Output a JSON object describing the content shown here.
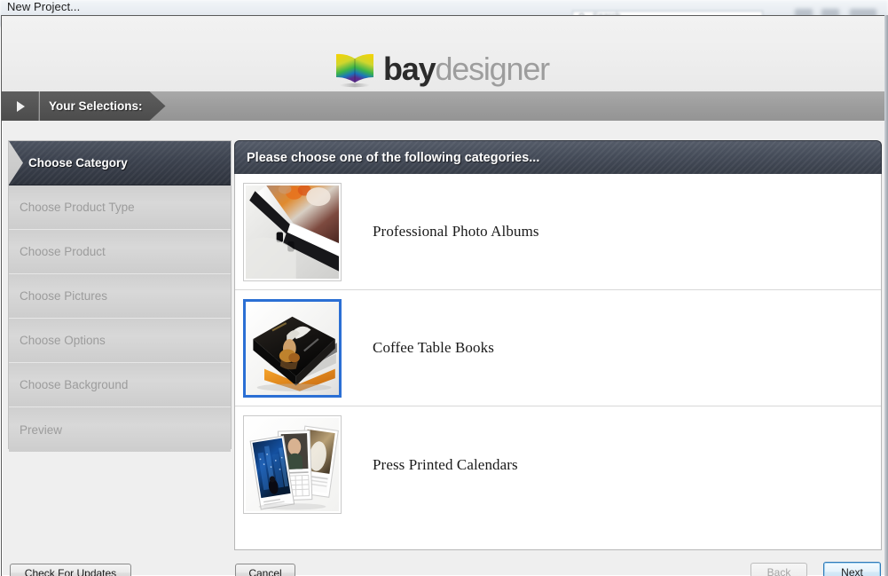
{
  "background_window": {
    "title": "New Project...",
    "search_placeholder": "Search",
    "search_icon": "search-icon",
    "minimize_label": "",
    "maximize_label": "",
    "close_label": ""
  },
  "branding": {
    "name_bold": "bay",
    "name_light": "designer",
    "logo_icon": "open-book-icon",
    "logo_colors": [
      "#f2d200",
      "#f59b00",
      "#8dc63f",
      "#00a651",
      "#2b3990",
      "#662d91"
    ]
  },
  "selections_bar": {
    "toggle_icon": "play-triangle-icon",
    "label": "Your Selections:"
  },
  "sidebar": {
    "steps": [
      {
        "label": "Choose Category",
        "state": "active"
      },
      {
        "label": "Choose Product Type",
        "state": "disabled"
      },
      {
        "label": "Choose Product",
        "state": "disabled"
      },
      {
        "label": "Choose Pictures",
        "state": "disabled"
      },
      {
        "label": "Choose Options",
        "state": "disabled"
      },
      {
        "label": "Choose Background",
        "state": "disabled"
      },
      {
        "label": "Preview",
        "state": "disabled"
      }
    ]
  },
  "content": {
    "header_title": "Please choose one of the following categories...",
    "categories": [
      {
        "label": "Professional Photo Albums",
        "thumb_icon": "photo-album-thumbnail",
        "selected": false
      },
      {
        "label": "Coffee Table Books",
        "thumb_icon": "coffee-table-book-thumbnail",
        "selected": true
      },
      {
        "label": "Press Printed Calendars",
        "thumb_icon": "calendar-stack-thumbnail",
        "selected": false
      }
    ]
  },
  "footer": {
    "check_updates_label": "Check For Updates",
    "cancel_label": "Cancel",
    "back_label": "Back",
    "next_label": "Next",
    "selection_accent_color": "#2b6fd4"
  }
}
